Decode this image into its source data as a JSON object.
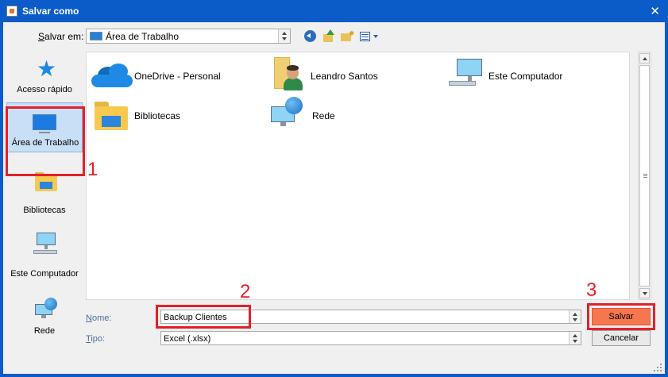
{
  "window": {
    "title": "Salvar como",
    "close": "✕"
  },
  "toolbar": {
    "save_in_label_underlined": "S",
    "save_in_label_rest": "alvar em:",
    "location": "Área de Trabalho"
  },
  "places": [
    {
      "label": "Acesso rápido",
      "icon": "star-icon"
    },
    {
      "label": "Área de Trabalho",
      "icon": "desktop-icon",
      "selected": true
    },
    {
      "label": "Bibliotecas",
      "icon": "libraries-folder-icon"
    },
    {
      "label": "Este Computador",
      "icon": "computer-icon"
    },
    {
      "label": "Rede",
      "icon": "network-icon"
    }
  ],
  "files": [
    {
      "label": "OneDrive - Personal",
      "icon": "onedrive-cloud-icon"
    },
    {
      "label": "Leandro Santos",
      "icon": "user-folder-icon"
    },
    {
      "label": "Este Computador",
      "icon": "computer-icon"
    },
    {
      "label": "Bibliotecas",
      "icon": "libraries-folder-icon"
    },
    {
      "label": "Rede",
      "icon": "network-icon"
    }
  ],
  "form": {
    "name_label_underlined": "N",
    "name_label_rest": "ome:",
    "name_value": "Backup Clientes",
    "type_label_underlined": "T",
    "type_label_rest": "ipo:",
    "type_value": "Excel (.xlsx)"
  },
  "buttons": {
    "save": "Salvar",
    "cancel": "Cancelar"
  },
  "annotations": {
    "one": "1",
    "two": "2",
    "three": "3",
    "color": "#e3202a"
  },
  "colors": {
    "titlebar": "#0b5cc8",
    "save_button": "#f5764f",
    "selection": "#c9dff5"
  }
}
